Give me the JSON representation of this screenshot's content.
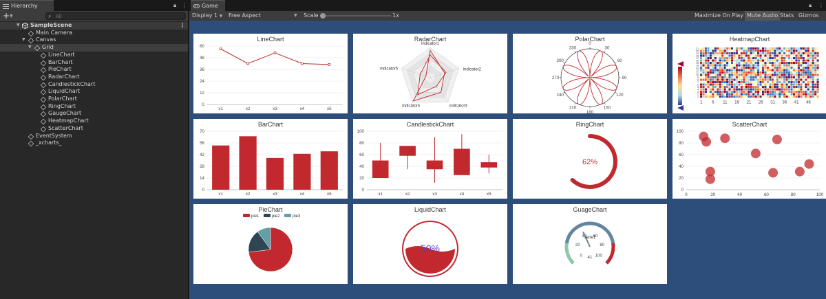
{
  "hierarchy": {
    "tab_label": "Hierarchy",
    "search_placeholder": "All",
    "add_label": "+",
    "scene": "SampleScene",
    "items": [
      {
        "label": "Main Camera",
        "depth": 1
      },
      {
        "label": "Canvas",
        "depth": 1,
        "expanded": true
      },
      {
        "label": "Grid",
        "depth": 2,
        "expanded": true,
        "selected": true
      },
      {
        "label": "LineChart",
        "depth": 3
      },
      {
        "label": "BarChart",
        "depth": 3
      },
      {
        "label": "PieChart",
        "depth": 3
      },
      {
        "label": "RadarChart",
        "depth": 3
      },
      {
        "label": "CandlestickChart",
        "depth": 3
      },
      {
        "label": "LiquidChart",
        "depth": 3
      },
      {
        "label": "PolarChart",
        "depth": 3
      },
      {
        "label": "RingChart",
        "depth": 3
      },
      {
        "label": "GaugeChart",
        "depth": 3
      },
      {
        "label": "HeatmapChart",
        "depth": 3
      },
      {
        "label": "ScatterChart",
        "depth": 3
      },
      {
        "label": "EventSystem",
        "depth": 1
      },
      {
        "label": "_xcharts_",
        "depth": 1
      }
    ]
  },
  "game": {
    "tab_label": "Game",
    "display": "Display 1",
    "aspect": "Free Aspect",
    "scale_label": "Scale",
    "scale_value": "1x",
    "buttons": [
      "Maximize On Play",
      "Mute Audio",
      "Stats",
      "Gizmos"
    ],
    "active_button": "Mute Audio",
    "canvas_color": "#2d4d7b"
  },
  "colors": {
    "accent": "#c1292e",
    "dark": "#2f4554",
    "teal": "#61a0a8"
  },
  "chart_data": [
    {
      "type": "line",
      "title": "LineChart",
      "categories": [
        "x1",
        "x2",
        "x3",
        "x4",
        "x5"
      ],
      "values": [
        57,
        42,
        53,
        42,
        41
      ],
      "ylim": [
        0,
        60
      ],
      "yticks": [
        "0",
        "12",
        "24",
        "36",
        "48",
        "60"
      ]
    },
    {
      "type": "radar",
      "title": "RadarChart",
      "indicators": [
        "indicator1",
        "indicator2",
        "indicator3",
        "indicator4",
        "indicator5"
      ],
      "series": [
        {
          "values": [
            0.9,
            0.5,
            0.6,
            0.95,
            0.15
          ]
        },
        {
          "values": [
            0.75,
            0.55,
            0.35,
            0.7,
            0.35
          ]
        }
      ]
    },
    {
      "type": "polar",
      "title": "PolarChart",
      "angle_ticks": [
        "0",
        "30",
        "60",
        "90",
        "120",
        "150",
        "180",
        "210",
        "240",
        "270",
        "300",
        "330"
      ],
      "petals": 8
    },
    {
      "type": "heatmap",
      "title": "HeatmapChart",
      "xticks": [
        "1",
        "6",
        "11",
        "16",
        "21",
        "26",
        "31",
        "36",
        "41",
        "46"
      ],
      "yticks": [
        "1",
        "2",
        "3",
        "4",
        "5",
        "6",
        "7",
        "8",
        "9",
        "10",
        "11",
        "12",
        "13",
        "14",
        "15",
        "16",
        "17",
        "18",
        "19",
        "20",
        "21"
      ],
      "visualmap_ticks": [
        "0.8",
        "0.6",
        "0.4",
        "0.2"
      ]
    },
    {
      "type": "bar",
      "title": "BarChart",
      "categories": [
        "x1",
        "x2",
        "x3",
        "x4",
        "x5"
      ],
      "values": [
        53,
        64,
        38,
        43,
        46
      ],
      "ylim": [
        0,
        70
      ],
      "yticks": [
        "0",
        "14",
        "28",
        "42",
        "56",
        "70"
      ]
    },
    {
      "type": "candlestick",
      "title": "CandlestickChart",
      "categories": [
        "x1",
        "x2",
        "x3",
        "x4",
        "x5"
      ],
      "ohlc": [
        {
          "open": 20,
          "close": 50,
          "low": 20,
          "high": 80
        },
        {
          "open": 58,
          "close": 75,
          "low": 35,
          "high": 75
        },
        {
          "open": 35,
          "close": 50,
          "low": 12,
          "high": 90
        },
        {
          "open": 25,
          "close": 70,
          "low": 25,
          "high": 95
        },
        {
          "open": 38,
          "close": 47,
          "low": 28,
          "high": 60
        }
      ],
      "ylim": [
        0,
        100
      ],
      "yticks": [
        "0",
        "20",
        "40",
        "60",
        "80",
        "100"
      ]
    },
    {
      "type": "ring",
      "title": "RingChart",
      "value": 62,
      "label": "62%"
    },
    {
      "type": "scatter",
      "title": "ScatterChart",
      "points": [
        [
          13,
          91
        ],
        [
          15,
          82
        ],
        [
          29,
          88
        ],
        [
          52,
          62
        ],
        [
          68,
          86
        ],
        [
          18,
          31
        ],
        [
          18,
          18
        ],
        [
          65,
          29
        ],
        [
          85,
          31
        ],
        [
          92,
          44
        ]
      ],
      "xlim": [
        0,
        100
      ],
      "ylim": [
        0,
        100
      ],
      "xticks": [
        "0",
        "20",
        "40",
        "60",
        "80",
        "100"
      ],
      "yticks": [
        "0",
        "20",
        "40",
        "60",
        "80",
        "100"
      ]
    },
    {
      "type": "pie",
      "title": "PieChart",
      "legend": [
        "pie1",
        "pie2",
        "pie3"
      ],
      "values": [
        73,
        17,
        10
      ]
    },
    {
      "type": "liquid",
      "title": "LiquidChart",
      "value": 50,
      "label": "50%"
    },
    {
      "type": "gauge",
      "title": "GuageChart",
      "value": 41,
      "label": "41",
      "series_label": "serie1",
      "ticks": [
        "0",
        "20",
        "40",
        "60",
        "80",
        "100"
      ]
    }
  ]
}
